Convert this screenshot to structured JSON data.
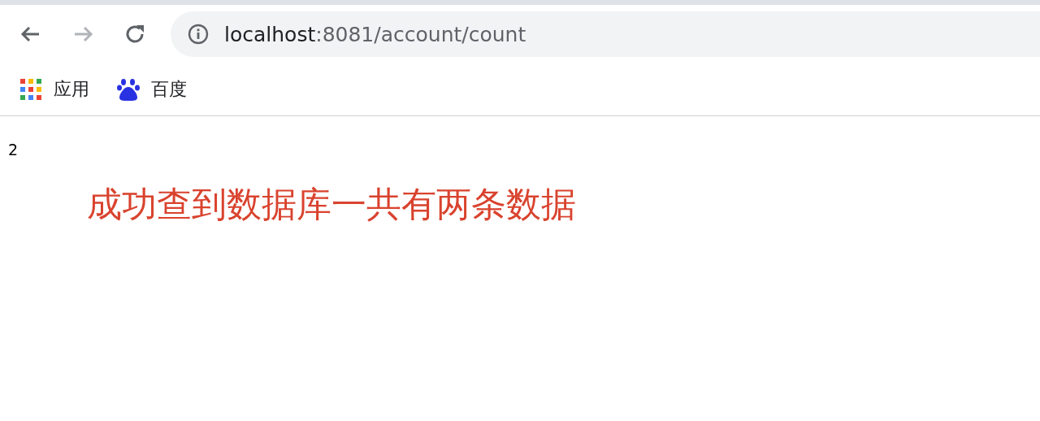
{
  "toolbar": {
    "back": {
      "disabled": false
    },
    "forward": {
      "disabled": true
    },
    "address": {
      "host": "localhost",
      "path": ":8081/account/count"
    }
  },
  "bookmarks": [
    {
      "kind": "apps",
      "label": "应用"
    },
    {
      "kind": "paw",
      "label": "百度"
    }
  ],
  "page": {
    "output": "2",
    "annotation": "成功查到数据库一共有两条数据"
  }
}
